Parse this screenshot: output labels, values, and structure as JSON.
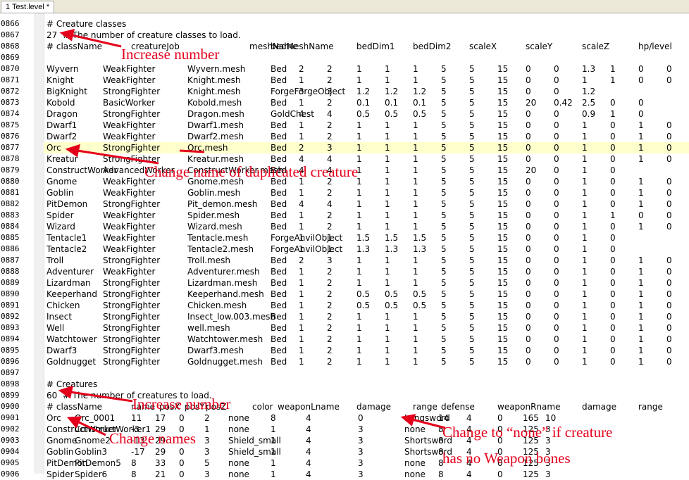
{
  "tab": {
    "label": "1 Test.level *"
  },
  "colors": {
    "annotation": "#e4001b",
    "highlight_row": "#ffffcc"
  },
  "lines": [
    {
      "n": "0866",
      "c": [
        "# Creature classes"
      ]
    },
    {
      "n": "0867",
      "c": [
        "27  # The number of creature classes to load."
      ]
    },
    {
      "n": "0868",
      "c": [
        "# className",
        "creatureJob",
        "meshName",
        "bedMeshName",
        "bedDim1",
        "bedDim2",
        "scaleX",
        "scaleY",
        "scaleZ",
        "hp/level"
      ]
    },
    {
      "n": "0869",
      "c": []
    },
    {
      "n": "0870",
      "c": [
        "Wyvern",
        "WeakFighter",
        "Wyvern.mesh",
        "Bed",
        "2",
        "2",
        "1",
        "1",
        "1",
        "5",
        "5",
        "15",
        "0",
        "0",
        "1.3",
        "1",
        "0",
        "0"
      ]
    },
    {
      "n": "0871",
      "c": [
        "Knight",
        "WeakFighter",
        "Knight.mesh",
        "Bed",
        "1",
        "2",
        "1",
        "1",
        "1",
        "5",
        "5",
        "15",
        "0",
        "0",
        "1",
        "1",
        "0",
        "0"
      ]
    },
    {
      "n": "0872",
      "c": [
        "BigKnight",
        "StrongFighter",
        "Knight.mesh",
        "ForgeForgeObject",
        "3",
        "3",
        "1.2",
        "1.2",
        "1.2",
        "5",
        "5",
        "15",
        "0",
        "0",
        "1.2"
      ]
    },
    {
      "n": "0873",
      "c": [
        "Kobold",
        "BasicWorker",
        "Kobold.mesh",
        "Bed",
        "1",
        "2",
        "0.1",
        "0.1",
        "0.1",
        "5",
        "5",
        "15",
        "20",
        "0.42",
        "2.5",
        "0",
        "0"
      ]
    },
    {
      "n": "0874",
      "c": [
        "Dragon",
        "StrongFighter",
        "Dragon.mesh",
        "GoldChest",
        "4",
        "4",
        "0.5",
        "0.5",
        "0.5",
        "5",
        "5",
        "15",
        "0",
        "0",
        "0.9",
        "1",
        "0"
      ]
    },
    {
      "n": "0875",
      "c": [
        "Dwarf1",
        "WeakFighter",
        "Dwarf1.mesh",
        "Bed",
        "1",
        "2",
        "1",
        "1",
        "1",
        "5",
        "5",
        "15",
        "0",
        "0",
        "1",
        "0",
        "1",
        "0"
      ]
    },
    {
      "n": "0876",
      "c": [
        "Dwarf2",
        "WeakFighter",
        "Dwarf2.mesh",
        "Bed",
        "1",
        "2",
        "1",
        "1",
        "1",
        "5",
        "5",
        "15",
        "0",
        "0",
        "1",
        "0",
        "1",
        "0"
      ]
    },
    {
      "n": "0877",
      "c": [
        "Orc",
        "StrongFighter",
        "Orc.mesh",
        "Bed",
        "2",
        "3",
        "1",
        "1",
        "1",
        "5",
        "5",
        "15",
        "0",
        "0",
        "1",
        "0",
        "1",
        "0",
        "0",
        "0"
      ]
    },
    {
      "n": "0878",
      "c": [
        "Kreatur",
        "StrongFighter",
        "Kreatur.mesh",
        "Bed",
        "4",
        "4",
        "1",
        "1",
        "1",
        "5",
        "5",
        "15",
        "0",
        "0",
        "1",
        "0",
        "1",
        "0"
      ]
    },
    {
      "n": "0879",
      "c": [
        "ConstructWorker",
        "AdvancedWorker",
        "ConstructWorker.mesh",
        "Bed",
        "4",
        "4",
        "1",
        "1",
        "1",
        "5",
        "5",
        "15",
        "20",
        "0",
        "1",
        "0"
      ]
    },
    {
      "n": "0880",
      "c": [
        "Gnome",
        "WeakFighter",
        "Gnome.mesh",
        "Bed",
        "1",
        "2",
        "1",
        "1",
        "1",
        "5",
        "5",
        "15",
        "0",
        "0",
        "1",
        "0",
        "1",
        "0"
      ]
    },
    {
      "n": "0881",
      "c": [
        "Goblin",
        "WeakFighter",
        "Goblin.mesh",
        "Bed",
        "1",
        "2",
        "1",
        "1",
        "1",
        "5",
        "5",
        "15",
        "0",
        "0",
        "1",
        "0",
        "1",
        "0"
      ]
    },
    {
      "n": "0882",
      "c": [
        "PitDemon",
        "StrongFighter",
        "Pit_demon.mesh",
        "Bed",
        "4",
        "4",
        "1",
        "1",
        "1",
        "5",
        "5",
        "15",
        "0",
        "0",
        "1",
        "0",
        "1",
        "0"
      ]
    },
    {
      "n": "0883",
      "c": [
        "Spider",
        "WeakFighter",
        "Spider.mesh",
        "Bed",
        "1",
        "2",
        "1",
        "1",
        "1",
        "5",
        "5",
        "15",
        "0",
        "0",
        "1",
        "1",
        "0",
        "0"
      ]
    },
    {
      "n": "0884",
      "c": [
        "Wizard",
        "WeakFighter",
        "Wizard.mesh",
        "Bed",
        "1",
        "2",
        "1",
        "1",
        "1",
        "5",
        "5",
        "15",
        "0",
        "0",
        "1",
        "0",
        "1",
        "0"
      ]
    },
    {
      "n": "0885",
      "c": [
        "Tentacle1",
        "WeakFighter",
        "Tentacle.mesh",
        "ForgeAnvilObject",
        "1",
        "1",
        "1.5",
        "1.5",
        "1.5",
        "5",
        "5",
        "15",
        "0",
        "0",
        "1",
        "0"
      ]
    },
    {
      "n": "0886",
      "c": [
        "Tentacle2",
        "WeakFighter",
        "Tentacle2.mesh",
        "ForgeAnvilObject",
        "1",
        "1",
        "1.3",
        "1.3",
        "1.3",
        "5",
        "5",
        "15",
        "0",
        "0",
        "1",
        "0"
      ]
    },
    {
      "n": "0887",
      "c": [
        "Troll",
        "StrongFighter",
        "Troll.mesh",
        "Bed",
        "2",
        "3",
        "1",
        "1",
        "1",
        "5",
        "5",
        "15",
        "0",
        "0",
        "1",
        "0",
        "1",
        "0",
        "0",
        "0"
      ]
    },
    {
      "n": "0888",
      "c": [
        "Adventurer",
        "WeakFighter",
        "Adventurer.mesh",
        "Bed",
        "1",
        "2",
        "1",
        "1",
        "1",
        "5",
        "5",
        "15",
        "0",
        "0",
        "1",
        "0",
        "1",
        "0"
      ]
    },
    {
      "n": "0889",
      "c": [
        "Lizardman",
        "StrongFighter",
        "Lizardman.mesh",
        "Bed",
        "1",
        "2",
        "1",
        "1",
        "1",
        "5",
        "5",
        "15",
        "0",
        "0",
        "1",
        "0",
        "1",
        "0"
      ]
    },
    {
      "n": "0890",
      "c": [
        "Keeperhand",
        "StrongFighter",
        "Keeperhand.mesh",
        "Bed",
        "1",
        "2",
        "0.5",
        "0.5",
        "0.5",
        "5",
        "5",
        "15",
        "0",
        "0",
        "1",
        "0",
        "1",
        "0"
      ]
    },
    {
      "n": "0891",
      "c": [
        "Chicken",
        "StrongFighter",
        "Chicken.mesh",
        "Bed",
        "1",
        "2",
        "0.5",
        "0.5",
        "0.5",
        "5",
        "5",
        "15",
        "0",
        "0",
        "1",
        "0",
        "1",
        "0"
      ]
    },
    {
      "n": "0892",
      "c": [
        "Insect",
        "StrongFighter",
        "Insect_low.003.mesh",
        "Bed",
        "1",
        "2",
        "1",
        "1",
        "1",
        "5",
        "5",
        "15",
        "0",
        "0",
        "1",
        "0",
        "1",
        "0"
      ]
    },
    {
      "n": "0893",
      "c": [
        "Well",
        "StrongFighter",
        "well.mesh",
        "Bed",
        "1",
        "2",
        "1",
        "1",
        "1",
        "5",
        "5",
        "15",
        "0",
        "0",
        "1",
        "0",
        "1",
        "0"
      ]
    },
    {
      "n": "0894",
      "c": [
        "Watchtower",
        "StrongFighter",
        "Watchtower.mesh",
        "Bed",
        "1",
        "2",
        "1",
        "1",
        "1",
        "5",
        "5",
        "15",
        "0",
        "0",
        "1",
        "0",
        "1",
        "0"
      ]
    },
    {
      "n": "0895",
      "c": [
        "Dwarf3",
        "StrongFighter",
        "Dwarf3.mesh",
        "Bed",
        "1",
        "2",
        "1",
        "1",
        "1",
        "5",
        "5",
        "15",
        "0",
        "0",
        "1",
        "0",
        "1",
        "0"
      ]
    },
    {
      "n": "0896",
      "c": [
        "Goldnugget",
        "StrongFighter",
        "Goldnugget.mesh",
        "Bed",
        "1",
        "2",
        "1",
        "1",
        "1",
        "5",
        "5",
        "15",
        "0",
        "0",
        "1",
        "0",
        "1",
        "0"
      ]
    },
    {
      "n": "0897",
      "c": []
    },
    {
      "n": "0898",
      "c": [
        "# Creatures"
      ]
    },
    {
      "n": "0899",
      "c": [
        "60  # The number of creatures to load."
      ]
    },
    {
      "n": "0900",
      "c": [
        "# className",
        "name",
        "posX",
        "posY",
        "posZ",
        "color",
        "weaponLname",
        "damage",
        "range",
        "defense",
        "weaponRname",
        "damage",
        "range",
        "defense"
      ]
    },
    {
      "n": "0901",
      "c": [
        "Orc",
        "Orc_0001",
        "11",
        "17",
        "0",
        "2",
        "none",
        "8",
        "4",
        "0",
        "Longsword",
        "14",
        "4",
        "0",
        "165",
        "10"
      ]
    },
    {
      "n": "0902",
      "c": [
        "ConstructWorker",
        "ConstructWorker1",
        "-3",
        "29",
        "0",
        "1",
        "none",
        "1",
        "4",
        "3",
        "none",
        "8",
        "4",
        "0",
        "125",
        "3"
      ]
    },
    {
      "n": "0903",
      "c": [
        "Gnome",
        "Gnome2",
        "-13",
        "29",
        "1",
        "3",
        "Shield_small",
        "1",
        "4",
        "3",
        "Shortsword",
        "8",
        "4",
        "0",
        "125",
        "3"
      ]
    },
    {
      "n": "0904",
      "c": [
        "Goblin",
        "Goblin3",
        "-17",
        "29",
        "0",
        "3",
        "Shield_small",
        "1",
        "4",
        "3",
        "Shortsword",
        "8",
        "4",
        "0",
        "125",
        "3"
      ]
    },
    {
      "n": "0905",
      "c": [
        "PitDemon",
        "PitDemon5",
        "8",
        "33",
        "0",
        "5",
        "none",
        "1",
        "4",
        "3",
        "none",
        "8",
        "4",
        "0",
        "125",
        "3"
      ]
    },
    {
      "n": "0906",
      "c": [
        "Spider",
        "Spider6",
        "8",
        "21",
        "0",
        "3",
        "none",
        "1",
        "4",
        "3",
        "none",
        "8",
        "4",
        "0",
        "125",
        "3"
      ]
    }
  ],
  "annotations": [
    "Increase number",
    "Change name of duplicated creature",
    "Increase number",
    "Change names",
    "Change to “none” if creature",
    "has no Weapon bones"
  ]
}
